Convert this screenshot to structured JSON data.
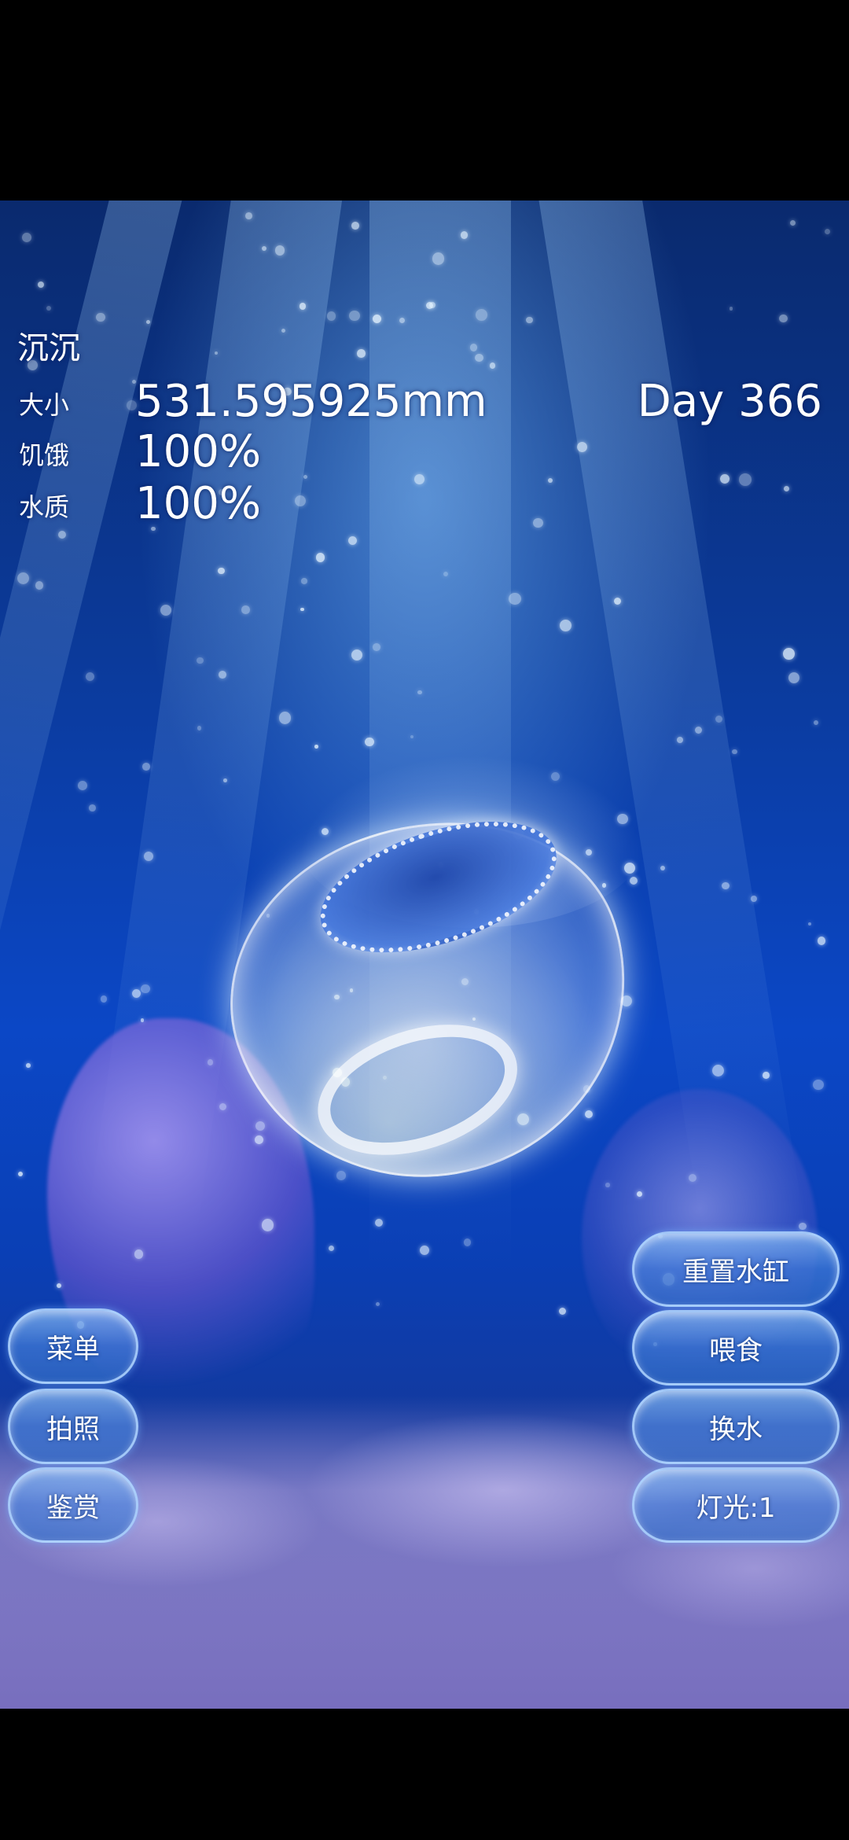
{
  "jellyfish": {
    "name": "沉沉",
    "size_label": "大小",
    "size_value": "531.595925mm",
    "hunger_label": "饥饿",
    "hunger_value": "100%",
    "water_label": "水质",
    "water_value": "100%",
    "day": "Day 366"
  },
  "left_buttons": {
    "menu": "菜单",
    "photo": "拍照",
    "appraise": "鉴赏"
  },
  "right_buttons": {
    "reset_tank": "重置水缸",
    "feed": "喂食",
    "change_water": "换水",
    "light": "灯光:1"
  },
  "colors": {
    "water_top": "#0a2a6e",
    "water_mid": "#0b47c6",
    "seabed": "#6d6fb8",
    "button_fill": "#4682dc",
    "text": "#ffffff"
  }
}
